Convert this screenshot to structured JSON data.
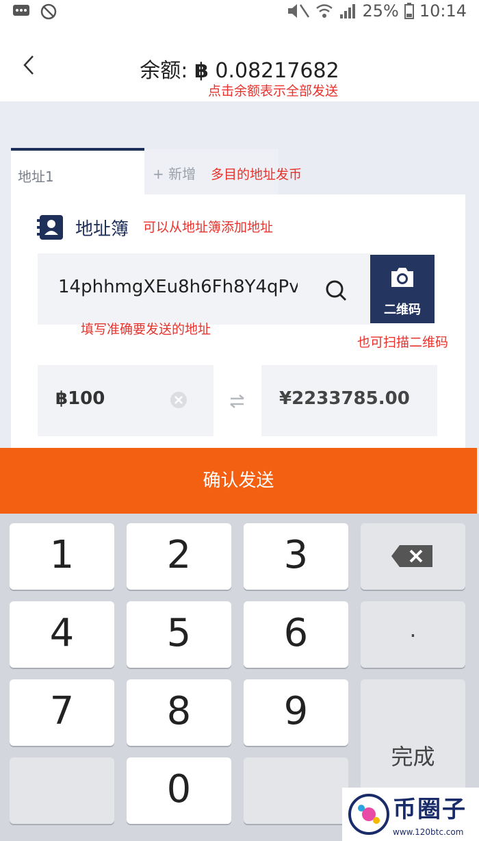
{
  "status": {
    "battery": "25%",
    "time": "10:14"
  },
  "header": {
    "balance_label": "余额:",
    "balance_symbol": "฿",
    "balance_value": "0.08217682",
    "balance_note": "点击余额表示全部发送"
  },
  "tabs": {
    "active_label": "地址1",
    "add_label": "+ 新增",
    "note": "多目的地址发币"
  },
  "address_book": {
    "label": "地址簿",
    "note": "可以从地址簿添加地址"
  },
  "address": {
    "value": "14phhmgXEu8h6Fh8Y4qPv",
    "note": "填写准确要发送的地址"
  },
  "qr": {
    "label": "二维码",
    "note": "也可扫描二维码"
  },
  "amount": {
    "btc": "฿100",
    "cny": "¥2233785.00"
  },
  "confirm_label": "确认发送",
  "keypad": {
    "keys": [
      "1",
      "2",
      "3",
      "4",
      "5",
      "6",
      "7",
      "8",
      "9",
      "0"
    ],
    "dot": ".",
    "done": "完成"
  },
  "watermark": {
    "text": "币圈子",
    "url": "www.120btc.com"
  },
  "colors": {
    "navy": "#1e2f59",
    "orange": "#f46011",
    "annotation": "#e8322b"
  }
}
